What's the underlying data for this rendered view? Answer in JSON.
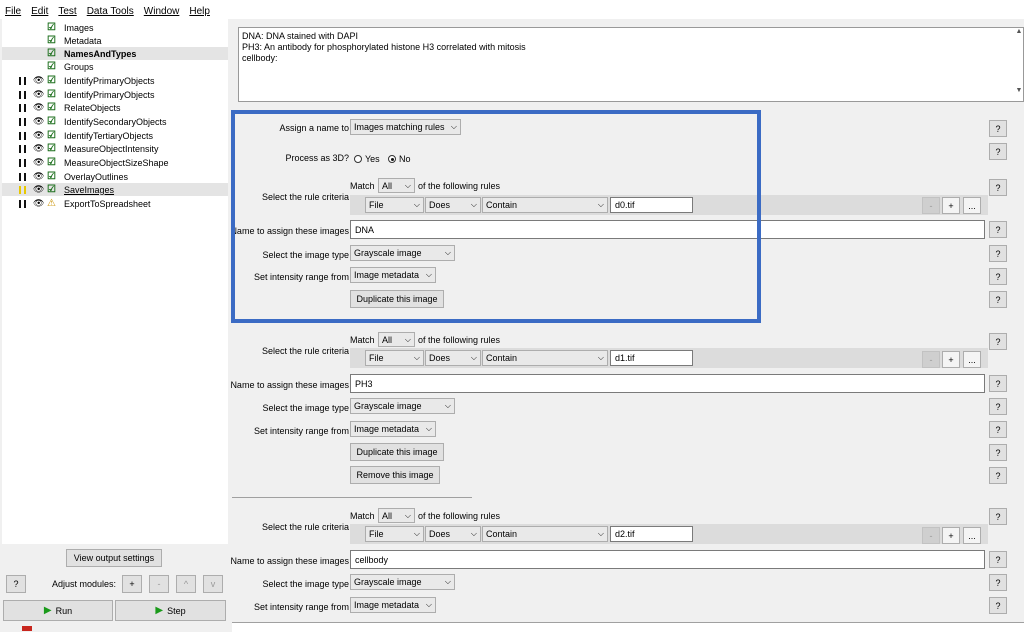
{
  "menu": [
    "File",
    "Edit",
    "Test",
    "Data Tools",
    "Window",
    "Help"
  ],
  "pipeline": {
    "input_modules": [
      "Images",
      "Metadata",
      "NamesAndTypes",
      "Groups"
    ],
    "modules": [
      "IdentifyPrimaryObjects",
      "IdentifyPrimaryObjects",
      "RelateObjects",
      "IdentifySecondaryObjects",
      "IdentifyTertiaryObjects",
      "MeasureObjectIntensity",
      "MeasureObjectSizeShape",
      "OverlayOutlines",
      "SaveImages",
      "ExportToSpreadsheet"
    ]
  },
  "bottom": {
    "view_output": "View output settings",
    "help": "?",
    "adjust_label": "Adjust modules:",
    "add": "+",
    "remove": "-",
    "up": "^",
    "down": "v",
    "run": "Run",
    "step": "Step"
  },
  "description": [
    "DNA: DNA stained with DAPI",
    "PH3: An antibody for phosphorylated histone H3 correlated with mitosis",
    "cellbody:"
  ],
  "settings": {
    "assign_label": "Assign a name to",
    "assign_value": "Images matching rules",
    "process3d_label": "Process as 3D?",
    "yes": "Yes",
    "no": "No",
    "rule_criteria_label": "Select the rule criteria",
    "match": "Match",
    "match_value": "All",
    "following": "of the following rules",
    "name_label": "Name to assign these images",
    "type_label": "Select the image type",
    "intensity_label": "Set intensity range from",
    "duplicate": "Duplicate this image",
    "remove": "Remove this image",
    "help": "?",
    "minus": "-",
    "plus": "+",
    "more": "..."
  },
  "images": [
    {
      "rule": [
        "File",
        "Does",
        "Contain",
        "d0.tif"
      ],
      "name": "DNA",
      "type": "Grayscale image",
      "intensity": "Image metadata"
    },
    {
      "rule": [
        "File",
        "Does",
        "Contain",
        "d1.tif"
      ],
      "name": "PH3",
      "type": "Grayscale image",
      "intensity": "Image metadata"
    },
    {
      "rule": [
        "File",
        "Does",
        "Contain",
        "d2.tif"
      ],
      "name": "cellbody",
      "type": "Grayscale image",
      "intensity": "Image metadata"
    }
  ],
  "colors": {
    "highlight": "#3b6bc4",
    "check": "#1b6e1b",
    "warning": "#c89000",
    "paused": "#e8c800"
  }
}
